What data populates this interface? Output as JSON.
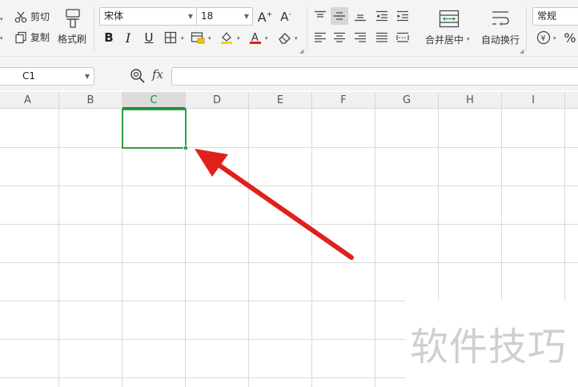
{
  "ribbon": {
    "clipboard": {
      "cut_label": "剪切",
      "copy_label": "复制",
      "format_painter_label": "格式刷"
    },
    "font": {
      "name": "宋体",
      "size": "18"
    },
    "alignment": {
      "merge_center_label": "合并居中",
      "wrap_text_label": "自动换行"
    },
    "number": {
      "format": "常规",
      "percent_symbol": "%"
    }
  },
  "formula_bar": {
    "cell_ref": "C1",
    "fx_label": "fx",
    "formula_value": ""
  },
  "sheet": {
    "columns": [
      "A",
      "B",
      "C",
      "D",
      "E",
      "F",
      "G",
      "H",
      "I"
    ],
    "active_column": "C",
    "selected_cell": "C1"
  },
  "colors": {
    "selection": "#2e9e46",
    "arrow": "#e0201c"
  },
  "watermark": {
    "text": "软件技巧"
  }
}
